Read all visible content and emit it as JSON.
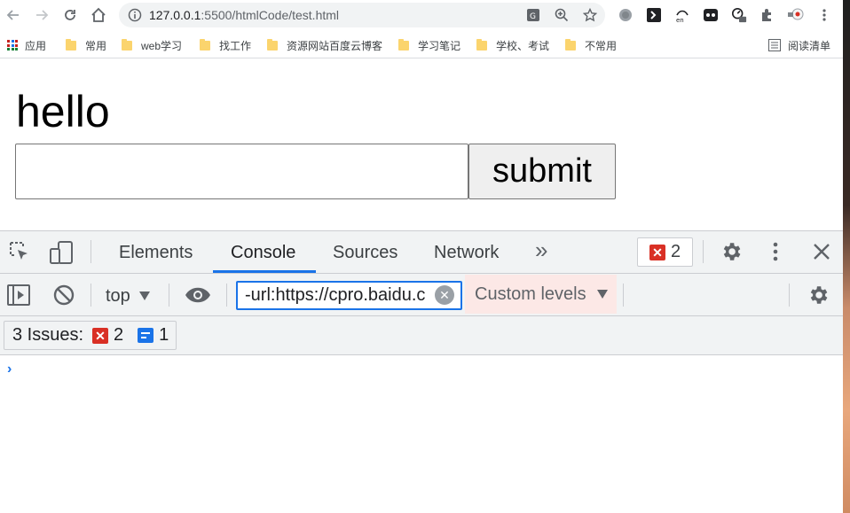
{
  "browser": {
    "url_host": "127.0.0.1",
    "url_rest": ":5500/htmlCode/test.html",
    "bookmarks": [
      {
        "label": "应用",
        "type": "apps"
      },
      {
        "label": "常用",
        "type": "folder"
      },
      {
        "label": "web学习",
        "type": "folder"
      },
      {
        "label": "找工作",
        "type": "folder"
      },
      {
        "label": "资源网站百度云博客",
        "type": "folder"
      },
      {
        "label": "学习笔记",
        "type": "folder"
      },
      {
        "label": "学校、考试",
        "type": "folder"
      },
      {
        "label": "不常用",
        "type": "folder"
      }
    ],
    "reading_list": "阅读清单"
  },
  "page": {
    "heading": "hello",
    "input_value": "",
    "submit_label": "submit"
  },
  "devtools": {
    "tabs": [
      "Elements",
      "Console",
      "Sources",
      "Network"
    ],
    "active_tab": "Console",
    "more_tabs": "»",
    "error_count": "2",
    "context": "top",
    "filter_value": "-url:https://cpro.baidu.c",
    "levels_label": "Custom levels",
    "issues_label": "3 Issues:",
    "issues_errors": "2",
    "issues_info": "1",
    "prompt": "›"
  },
  "colors": {
    "accent": "#1a73e8",
    "error": "#d93025",
    "levels_bg": "#fce8e6"
  }
}
